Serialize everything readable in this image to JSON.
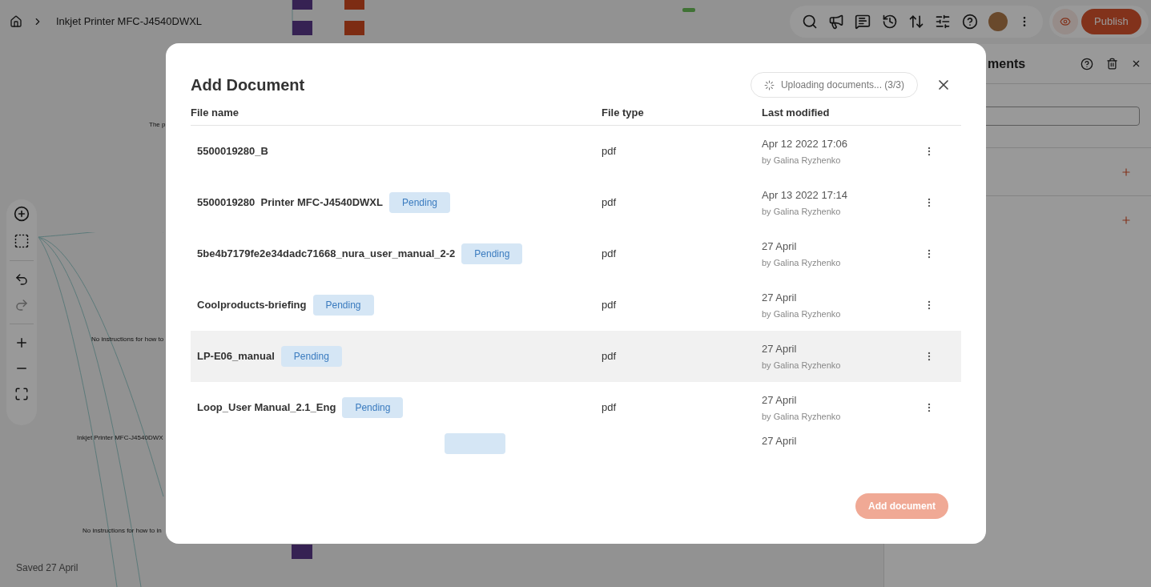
{
  "breadcrumb": {
    "title": "Inkjet Printer MFC-J4540DWXL"
  },
  "toolbar": {
    "publish": "Publish"
  },
  "canvas": {
    "labels": [
      {
        "text": "The p"
      },
      {
        "text": "No instructions for how to"
      },
      {
        "text": "Inkjet Printer MFC-J4540DWX"
      },
      {
        "text": "No instructions for how to in"
      }
    ]
  },
  "status": "Saved 27 April",
  "side_panel": {
    "title": "ments"
  },
  "dialog": {
    "title": "Add Document",
    "upload_status": "Uploading documents... (3/3)",
    "columns": [
      "File name",
      "File type",
      "Last modified"
    ],
    "rows": [
      {
        "name": "5500019280_B",
        "badge": "",
        "type": "pdf",
        "date": "Apr 12 2022 17:06",
        "by": "by Galina Ryzhenko",
        "highlighted": false
      },
      {
        "name": "5500019280  Printer MFC-J4540DWXL",
        "badge": "Pending",
        "type": "pdf",
        "date": "Apr 13 2022 17:14",
        "by": "by Galina Ryzhenko",
        "highlighted": false
      },
      {
        "name": "5be4b7179fe2e34dadc71668_nura_user_manual_2-2",
        "badge": "Pending",
        "type": "pdf",
        "date": "27 April",
        "by": "by Galina Ryzhenko",
        "highlighted": false
      },
      {
        "name": "Coolproducts-briefing",
        "badge": "Pending",
        "type": "pdf",
        "date": "27 April",
        "by": "by Galina Ryzhenko",
        "highlighted": false
      },
      {
        "name": "LP-E06_manual",
        "badge": "Pending",
        "type": "pdf",
        "date": "27 April",
        "by": "by Galina Ryzhenko",
        "highlighted": true
      },
      {
        "name": "Loop_User Manual_2.1_Eng",
        "badge": "Pending",
        "type": "pdf",
        "date": "27 April",
        "by": "by Galina Ryzhenko",
        "highlighted": false
      }
    ],
    "partial_row": {
      "date": "27 April"
    },
    "add_button": {
      "label": "Add document",
      "disabled": true
    }
  }
}
